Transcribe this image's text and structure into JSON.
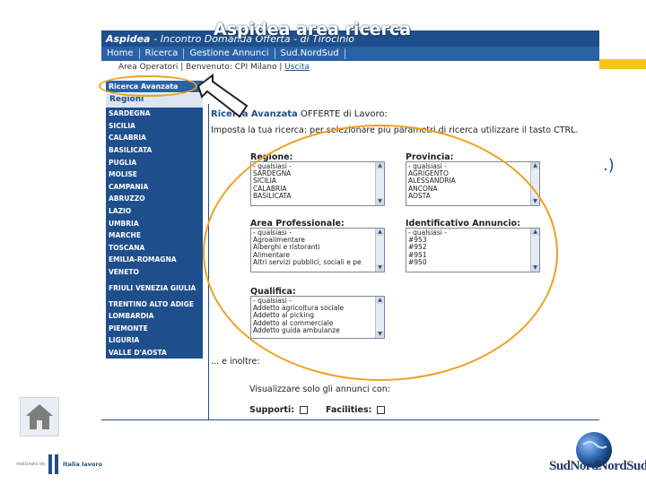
{
  "slide": {
    "title": "Aspidea area ricerca",
    "side_text": ".)"
  },
  "app": {
    "banner_title": "Aspidea",
    "banner_subtitle": "- Incontro Domanda Offerta - di Tirocinio"
  },
  "nav": {
    "items": [
      "Home",
      "Ricerca",
      "Gestione Annunci",
      "Sud.NordSud"
    ]
  },
  "user_bar": {
    "area": "Area Operatori",
    "welcome": "Benvenuto: CPI Milano",
    "logout": "Uscita"
  },
  "sidebar": {
    "advanced_search": "Ricerca Avanzata",
    "heading": "Regioni",
    "regions": [
      "SARDEGNA",
      "SICILIA",
      "CALABRIA",
      "BASILICATA",
      "PUGLIA",
      "MOLISE",
      "CAMPANIA",
      "ABRUZZO",
      "LAZIO",
      "UMBRIA",
      "MARCHE",
      "TOSCANA",
      "EMILIA-ROMAGNA",
      "VENETO",
      "FRIULI VENEZIA GIULIA",
      "TRENTINO ALTO ADIGE",
      "LOMBARDIA",
      "PIEMONTE",
      "LIGURIA",
      "VALLE D'AOSTA"
    ]
  },
  "search": {
    "title_prefix": "Ricerca Avanzata",
    "title_main": "OFFERTE di Lavoro:",
    "instruction": "Imposta la tua ricerca: per selezionare più parametri di ricerca utilizzare il tasto CTRL.",
    "regione": {
      "label": "Regione:",
      "options": [
        "- qualsiasi -",
        "SARDEGNA",
        "SICILIA",
        "CALABRIA",
        "BASILICATA"
      ]
    },
    "provincia": {
      "label": "Provincia:",
      "options": [
        "- qualsiasi -",
        "AGRIGENTO",
        "ALESSANDRIA",
        "ANCONA",
        "AOSTA"
      ]
    },
    "area_professionale": {
      "label": "Area Professionale:",
      "options": [
        "- qualsiasi -",
        "Agroalimentare",
        "Alberghi e ristoranti",
        "Alimentare",
        "Altri servizi pubblici, sociali e pe"
      ]
    },
    "identificativo": {
      "label": "Identificativo Annuncio:",
      "options": [
        "- qualsiasi -",
        "#953",
        "#952",
        "#951",
        "#950"
      ]
    },
    "qualifica": {
      "label": "Qualifica:",
      "options": [
        "- qualsiasi -",
        "Addetto agricoltura sociale",
        "Addetto al picking",
        "Addetto al commerciale",
        "Addetto guida ambulanze"
      ]
    },
    "inoltre": "... e inoltre:",
    "visualizza": "Visualizzare solo gli annunci con:",
    "supporti_label": "Supporti:",
    "facilities_label": "Facilities:"
  },
  "footer": {
    "left_small": "realizzato da",
    "left_name": "Italia lavoro",
    "right_name": "SudNordNordSud"
  },
  "colors": {
    "primary": "#1f4e8c",
    "accent": "#f0a020",
    "yellow": "#f5c518"
  }
}
